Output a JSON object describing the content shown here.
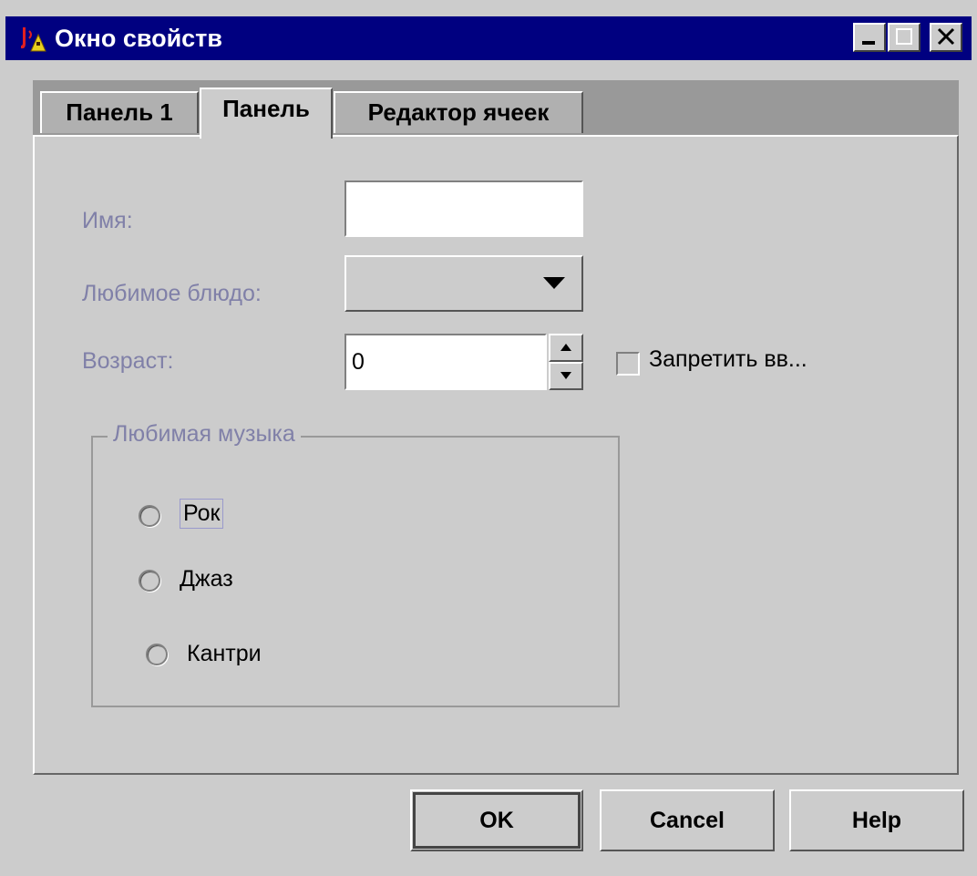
{
  "window": {
    "title": "Окно свойств",
    "controls": [
      "minimize-icon",
      "maximize-icon",
      "close-icon"
    ]
  },
  "tabs": [
    {
      "label": "Панель 1",
      "selected": false
    },
    {
      "label": "Панель",
      "selected": true
    },
    {
      "label": "Редактор ячеек",
      "selected": false
    }
  ],
  "form": {
    "name_label": "Имя:",
    "name_value": "",
    "food_label": "Любимое блюдо:",
    "food_value": "",
    "age_label": "Возраст:",
    "age_value": "0",
    "disable_checkbox_label": "Запретить вв...",
    "disable_checked": false
  },
  "music_group": {
    "title": "Любимая музыка",
    "options": [
      {
        "label": "Рок",
        "selected": false,
        "focused": true
      },
      {
        "label": "Джаз",
        "selected": false
      },
      {
        "label": "Кантри",
        "selected": false
      }
    ]
  },
  "buttons": {
    "ok": "OK",
    "cancel": "Cancel",
    "help": "Help"
  },
  "colors": {
    "titlebar": "#000080",
    "panel": "#cccccc",
    "disabled_label": "#8080a8"
  }
}
